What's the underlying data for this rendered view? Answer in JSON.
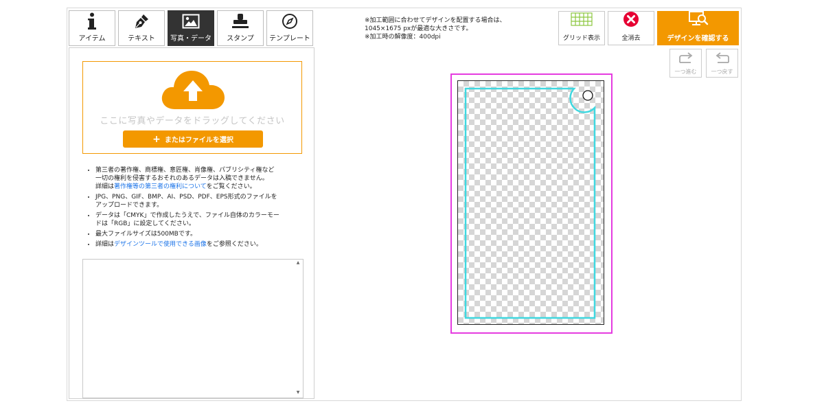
{
  "tabs": [
    {
      "label": "アイテム",
      "icon": "info-icon",
      "active": false
    },
    {
      "label": "テキスト",
      "icon": "pen-icon",
      "active": false
    },
    {
      "label": "写真・データ",
      "icon": "image-icon",
      "active": true
    },
    {
      "label": "スタンプ",
      "icon": "stamp-icon",
      "active": false
    },
    {
      "label": "テンプレート",
      "icon": "compass-icon",
      "active": false
    }
  ],
  "upload": {
    "drop_text": "ここに写真やデータをドラッグしてください",
    "select_label": "またはファイルを選択",
    "icon": "cloud-upload-icon"
  },
  "notes": {
    "n1_line1": "第三者の著作権、商標権、意匠権、肖像権、パブリシティ権など",
    "n1_line2": "一切の権利を侵害するおそれのあるデータは入稿できません。",
    "n1_pre": "詳細は",
    "n1_link": "著作権等の第三者の権利について",
    "n1_post": "をご覧ください。",
    "n2_line1": "JPG、PNG、GIF、BMP、AI、PSD、PDF、EPS形式のファイルを",
    "n2_line2": "アップロードできます。",
    "n3_line1": "データは「CMYK」で作成したうえで、ファイル自体のカラーモー",
    "n3_line2": "ドは「RGB」に設定してください。",
    "n4": "最大ファイルサイズは500MBです。",
    "n5_pre": "詳細は",
    "n5_link": "デザインツールで使用できる画像",
    "n5_post": "をご参照ください。"
  },
  "memo": {
    "value": ""
  },
  "info": {
    "line1": "※加工範囲に合わせてデザインを配置する場合は、",
    "line2": "1045×1675 pxが最適な大きさです。",
    "line3": "※加工時の解像度：400dpi"
  },
  "toolbar": {
    "grid_label": "グリッド表示",
    "clear_label": "全消去",
    "confirm_label": "デザインを確認する",
    "redo_label": "一つ進む",
    "undo_label": "一つ戻す"
  },
  "colors": {
    "accent": "#f39800",
    "grid_icon": "#8cc63f",
    "clear_icon": "#e60033",
    "print_area": "#e53be0",
    "safe_area": "#40d8e0"
  }
}
